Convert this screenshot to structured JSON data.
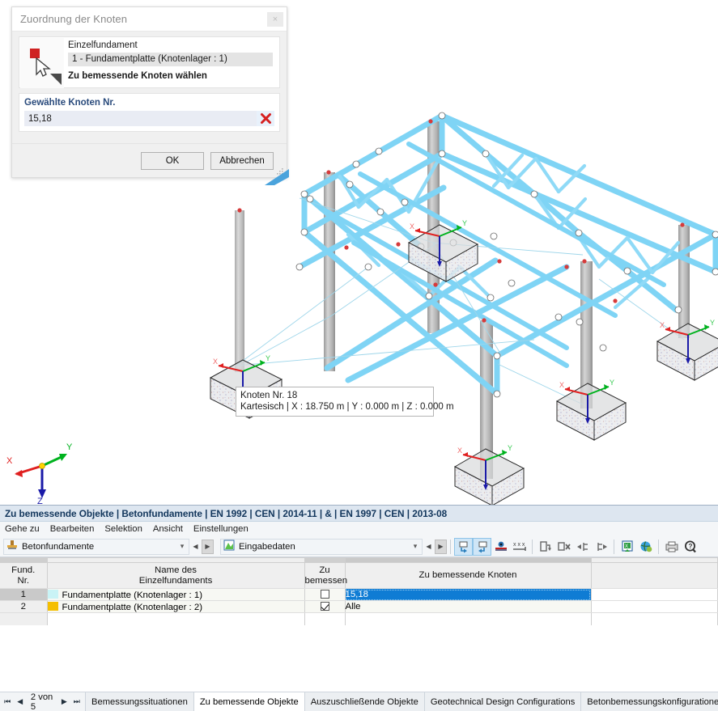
{
  "viewport": {
    "name": "3d-structure-view",
    "global_axes": {
      "x": "X",
      "y": "Y",
      "z": "Z"
    },
    "foundation_axes": {
      "x": "X",
      "y": "Y",
      "z": "Z"
    },
    "tooltip": {
      "line1": "Knoten Nr. 18",
      "line2": "Kartesisch | X : 18.750 m | Y : 0.000 m | Z : 0.000 m"
    },
    "colors": {
      "member": "#7fd4f5",
      "column": "#b0b0b0",
      "axis_x": "#e02020",
      "axis_y": "#00b21e",
      "axis_z": "#1a1aa8",
      "node": "#ffffff",
      "node_support": "#d63b3b"
    }
  },
  "dialog": {
    "title": "Zuordnung der Knoten",
    "close_label": "×",
    "thumbnail_name": "foundation-pick-thumbnail",
    "foundation_label": "Einzelfundament",
    "foundation_value": "1 - Fundamentplatte (Knotenlager : 1)",
    "hint": "Zu bemessende Knoten wählen",
    "nodes_legend": "Gewählte Knoten Nr.",
    "nodes_value": "15,18",
    "nodes_placeholder": "",
    "clear_label": "✖",
    "ok_label": "OK",
    "cancel_label": "Abbrechen"
  },
  "panel": {
    "header": "Zu bemessende Objekte | Betonfundamente | EN 1992 | CEN | 2014-11 | & | EN 1997 | CEN | 2013-08",
    "menu": [
      "Gehe zu",
      "Bearbeiten",
      "Selektion",
      "Ansicht",
      "Einstellungen"
    ],
    "combo_left": {
      "value": "Betonfundamente",
      "icon": "foundation-icon"
    },
    "combo_right": {
      "value": "Eingabedaten",
      "icon": "input-data-icon"
    },
    "toolbar_buttons": [
      {
        "name": "select-objects-button",
        "glyph": "↶",
        "active": true
      },
      {
        "name": "deselect-objects-button",
        "glyph": "↷",
        "active": true
      },
      {
        "name": "show-selected-button",
        "glyph": "◉",
        "active": false
      },
      {
        "name": "show-values-button",
        "glyph": "xxx",
        "active": false
      },
      {
        "name": "insert-row-button",
        "glyph": "↵",
        "active": false
      },
      {
        "name": "delete-row-button",
        "glyph": "✖",
        "active": false
      },
      {
        "name": "import-button",
        "glyph": "←",
        "active": false
      },
      {
        "name": "export-button",
        "glyph": "→",
        "active": false
      },
      {
        "name": "export-excel-button",
        "glyph": "▤",
        "active": false
      },
      {
        "name": "globe-settings-button",
        "glyph": "●",
        "active": false
      },
      {
        "name": "print-button",
        "glyph": "⎙",
        "active": false
      },
      {
        "name": "help-button",
        "glyph": "?",
        "active": false
      }
    ]
  },
  "grid": {
    "columns": [
      {
        "key": "num",
        "line1": "Fund.",
        "line2": "Nr."
      },
      {
        "key": "name",
        "line1": "Name des",
        "line2": "Einzelfundaments"
      },
      {
        "key": "design",
        "line1": "Zu",
        "line2": "bemessen"
      },
      {
        "key": "nodes",
        "line1": "",
        "line2": "Zu bemessende Knoten"
      },
      {
        "key": "blank",
        "line1": "",
        "line2": ""
      }
    ],
    "rows": [
      {
        "num": "1",
        "swatch": "#c9f3f6",
        "name": "Fundamentplatte (Knotenlager : 1)",
        "design_checked": false,
        "nodes": "15,18",
        "nodes_selected": true
      },
      {
        "num": "2",
        "swatch": "#f5bf00",
        "name": "Fundamentplatte (Knotenlager : 2)",
        "design_checked": true,
        "nodes": "Alle",
        "nodes_selected": false
      }
    ]
  },
  "tabbar": {
    "pager": {
      "first": "⏮",
      "prev": "◀",
      "label": "2 von 5",
      "next": "▶",
      "last": "⏭"
    },
    "tabs": [
      {
        "label": "Bemessungssituationen",
        "active": false
      },
      {
        "label": "Zu bemessende Objekte",
        "active": true
      },
      {
        "label": "Auszuschließende Objekte",
        "active": false
      },
      {
        "label": "Geotechnical Design Configurations",
        "active": false
      },
      {
        "label": "Betonbemessungskonfigurationen",
        "active": false
      }
    ]
  }
}
